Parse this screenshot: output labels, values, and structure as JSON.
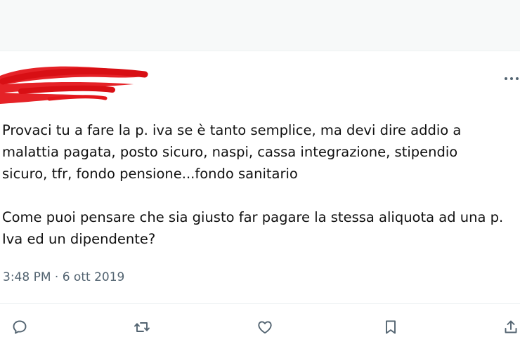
{
  "tweet": {
    "lines_par1": [
      "Provaci tu a fare la p. iva se è tanto semplice, ma devi dire addio a",
      "malattia pagata, posto sicuro, naspi, cassa integrazione, stipendio",
      "sicuro, tfr, fondo pensione...fondo sanitario"
    ],
    "lines_par2": [
      "Come puoi pensare che sia giusto far pagare la stessa aliquota ad una p.",
      "Iva ed un dipendente?"
    ],
    "timestamp": "3:48 PM · 6 ott 2019"
  },
  "icons": {
    "more": "more-options-icon",
    "reply": "reply-icon",
    "retweet": "retweet-icon",
    "like": "heart-icon",
    "bookmark": "bookmark-icon",
    "share": "share-icon"
  },
  "colors": {
    "text": "#111111",
    "secondary": "#536471",
    "icon": "#536471",
    "redaction": "#e4161b"
  }
}
